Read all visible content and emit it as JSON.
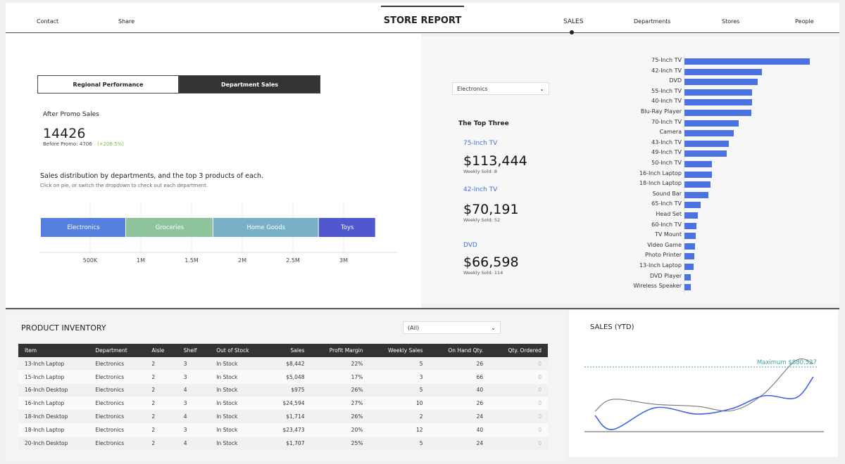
{
  "header": {
    "title": "STORE REPORT",
    "left_links": [
      "Contact",
      "Share"
    ],
    "tabs": [
      "SALES",
      "Departments",
      "Stores",
      "People"
    ],
    "active_tab": "SALES"
  },
  "toggle": {
    "options": [
      "Regional Performance",
      "Department Sales"
    ],
    "active": "Department Sales"
  },
  "promo": {
    "label": "After Promo Sales",
    "value": "14426",
    "before": "Before Promo: 4706",
    "change": "(+206.5%)",
    "change_color": "#6bbf4e"
  },
  "distribution": {
    "title": "Sales distribution by departments, and the top 3 products of each.",
    "subtitle": "Click on pie, or switch the dropdown to check out each department."
  },
  "chart_data": [
    {
      "type": "bar",
      "orientation": "horizontal-stacked",
      "categories": [
        "Electronics",
        "Groceries",
        "Home Goods",
        "Toys"
      ],
      "values": [
        840000,
        861000,
        1040000,
        563000
      ],
      "colors": [
        "#5580e0",
        "#8ec49b",
        "#78b0c8",
        "#4f58cf"
      ],
      "xticks": [
        "500K",
        "1M",
        "1.5M",
        "2M",
        "2.5M",
        "3M"
      ],
      "xlim": [
        0,
        3400000
      ],
      "grid": true
    },
    {
      "type": "bar",
      "orientation": "horizontal",
      "categories": [
        "75-Inch TV",
        "42-Inch TV",
        "DVD",
        "55-Inch TV",
        "40-Inch TV",
        "Blu-Ray Player",
        "70-Inch TV",
        "Camera",
        "43-Inch TV",
        "49-Inch TV",
        "50-Inch TV",
        "16-Inch Laptop",
        "18-Inch Laptop",
        "Sound Bar",
        "65-Inch TV",
        "Head Set",
        "60-Inch TV",
        "TV Mount",
        "Video Game",
        "Photo Printer",
        "13-Inch Laptop",
        "DVD Player",
        "Wireless Speaker"
      ],
      "values": [
        113444,
        70191,
        66598,
        61000,
        61000,
        60500,
        49000,
        44600,
        40100,
        38200,
        24800,
        24594,
        23473,
        21600,
        14600,
        12100,
        10800,
        10200,
        9600,
        8900,
        8442,
        5700,
        5700
      ],
      "color": "#4a72e0"
    },
    {
      "type": "line",
      "title": "SALES (YTD)",
      "series": [
        {
          "values": [
            277000,
            440000,
            373000,
            345000,
            287000,
            517000,
            967000,
            928000
          ],
          "color": "#777777"
        },
        {
          "values": [
            220000,
            29000,
            325000,
            239000,
            316000,
            488000,
            459000,
            746000
          ],
          "color": "#3f66e8"
        }
      ],
      "reference_line": {
        "label": "Maximum $880,527",
        "value": 880527,
        "color": "#3aa79a"
      },
      "ylim": [
        0,
        1000000
      ]
    }
  ],
  "department_select": {
    "value": "Electronics"
  },
  "top_three": {
    "title": "The Top Three",
    "items": [
      {
        "name": "75-Inch TV",
        "value": "$113,444",
        "sub": "Weekly Sold: 8"
      },
      {
        "name": "42-Inch TV",
        "value": "$70,191",
        "sub": "Weekly Sold: 52"
      },
      {
        "name": "DVD",
        "value": "$66,598",
        "sub": "Weekly Sold: 114"
      }
    ]
  },
  "inventory": {
    "title": "PRODUCT INVENTORY",
    "filter": "(All)",
    "columns": [
      "Item",
      "Department",
      "Aisle",
      "Shelf",
      "Out of Stock",
      "Sales",
      "Profit Margin",
      "Weekly Sales",
      "On Hand Qty.",
      "Qty. Ordered"
    ],
    "rows": [
      [
        "13-Inch Laptop",
        "Electronics",
        "2",
        "3",
        "In Stock",
        "$8,442",
        "22%",
        "5",
        "26",
        "0"
      ],
      [
        "15-Inch Laptop",
        "Electronics",
        "2",
        "3",
        "In Stock",
        "$5,048",
        "17%",
        "3",
        "66",
        "0"
      ],
      [
        "16-Inch Desktop",
        "Electronics",
        "2",
        "4",
        "In Stock",
        "$975",
        "26%",
        "5",
        "40",
        "0"
      ],
      [
        "16-Inch Laptop",
        "Electronics",
        "2",
        "3",
        "In Stock",
        "$24,594",
        "27%",
        "10",
        "26",
        "0"
      ],
      [
        "18-Inch Desktop",
        "Electronics",
        "2",
        "4",
        "In Stock",
        "$1,714",
        "26%",
        "2",
        "24",
        "0"
      ],
      [
        "18-Inch Laptop",
        "Electronics",
        "2",
        "3",
        "In Stock",
        "$23,473",
        "20%",
        "12",
        "40",
        "0"
      ],
      [
        "20-Inch Desktop",
        "Electronics",
        "2",
        "4",
        "In Stock",
        "$1,707",
        "25%",
        "5",
        "24",
        "0"
      ]
    ]
  }
}
